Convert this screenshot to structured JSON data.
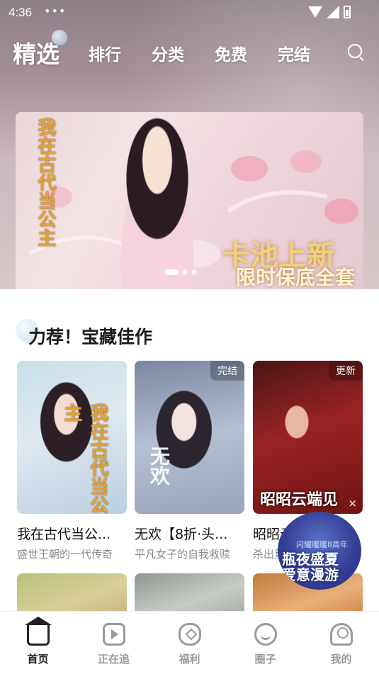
{
  "status_bar": {
    "time": "4:36",
    "dots": "•••"
  },
  "top_nav": {
    "tabs": [
      {
        "label": "精选",
        "active": true
      },
      {
        "label": "排行",
        "active": false
      },
      {
        "label": "分类",
        "active": false
      },
      {
        "label": "免费",
        "active": false
      },
      {
        "label": "完结",
        "active": false
      }
    ],
    "search_icon": "search-icon"
  },
  "banner": {
    "vertical_text": "我在古代当公主",
    "title": "卡池上新",
    "subtitle": "限时保底全套",
    "dots_count": 3,
    "active_dot": 0
  },
  "section": {
    "title": "力荐！宝藏佳作"
  },
  "cards": [
    {
      "cover_text": "我在古代当公主",
      "badge": "",
      "title": "我在古代当公...",
      "desc": "盛世王朝的一代传奇"
    },
    {
      "cover_text": "无欢",
      "badge": "完结",
      "title": "无欢【8折·头...",
      "desc": "平凡女子的自我救赎"
    },
    {
      "cover_text": "昭昭云端见",
      "badge": "更新",
      "title": "昭昭云端见",
      "desc": "杀出重围"
    }
  ],
  "floating_ad": {
    "small_text": "闪耀暖暖8周年",
    "text_line1": "瓶夜盛夏",
    "text_line2": "爱意漫游",
    "close": "×"
  },
  "card_close": "×",
  "tabbar": {
    "items": [
      {
        "label": "首页",
        "icon": "home-icon",
        "active": true
      },
      {
        "label": "正在追",
        "icon": "play-icon",
        "active": false
      },
      {
        "label": "福利",
        "icon": "gift-icon",
        "active": false
      },
      {
        "label": "圈子",
        "icon": "circle-icon",
        "active": false
      },
      {
        "label": "我的",
        "icon": "user-icon",
        "active": false
      }
    ]
  },
  "colors": {
    "accent": "#222222",
    "inactive": "#9a9a9a",
    "banner_title": "#f2d27a"
  }
}
